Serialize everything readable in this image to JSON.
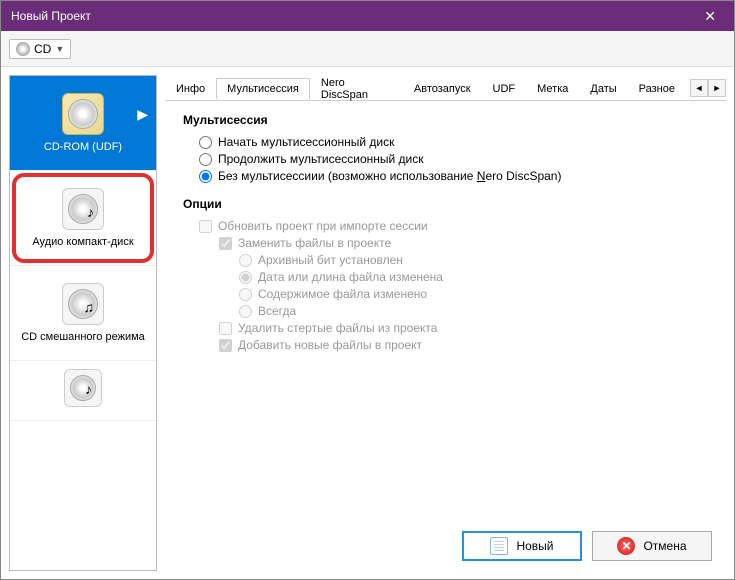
{
  "window": {
    "title": "Новый Проект"
  },
  "toolbar": {
    "disc_type": "CD"
  },
  "sidebar": {
    "items": [
      {
        "label": "CD-ROM (UDF)"
      },
      {
        "label": "Аудио компакт-диск"
      },
      {
        "label": "CD смешанного режима"
      },
      {
        "label": ""
      }
    ]
  },
  "tabs": {
    "items": [
      "Инфо",
      "Мультисессия",
      "Nero DiscSpan",
      "Автозапуск",
      "UDF",
      "Метка",
      "Даты",
      "Разное"
    ],
    "active_index": 1
  },
  "multisession": {
    "title": "Мультисессия",
    "radio_start": "Начать мультисессионный диск",
    "radio_continue": "Продолжить мультисессионный диск",
    "radio_none_prefix": "Без мультисессиии (возможно использование ",
    "radio_none_nero": "N",
    "radio_none_suffix": "ero DiscSpan)"
  },
  "options": {
    "title": "Опции",
    "update_project": "Обновить проект при импорте сессии",
    "replace_files": "Заменить файлы в проекте",
    "archive_bit": "Архивный бит установлен",
    "date_changed": "Дата или длина файла изменена",
    "content_changed": "Содержимое файла изменено",
    "always": "Всегда",
    "delete_erased": "Удалить стертые файлы из проекта",
    "add_new": "Добавить новые файлы в проект"
  },
  "footer": {
    "new_btn": "Новый",
    "cancel_btn": "Отмена"
  }
}
